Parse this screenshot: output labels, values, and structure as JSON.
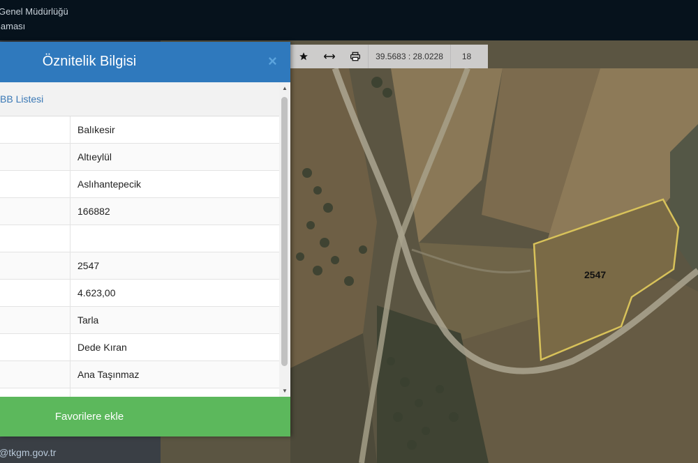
{
  "header": {
    "line1": "Genel Müdürlüğü",
    "line2": "laması"
  },
  "footer": {
    "email": "@tkgm.gov.tr"
  },
  "toolbar": {
    "star_icon": "star-icon",
    "measure_icon": "arrows-horizontal-icon",
    "print_icon": "print-icon",
    "coordinates": "39.5683 : 28.0228",
    "zoom_level": "18"
  },
  "map": {
    "parcel_label": "2547"
  },
  "panel": {
    "title": "Öznitelik Bilgisi",
    "close_symbol": "×",
    "section_title": "BB Listesi",
    "rows": [
      {
        "value": "Balıkesir"
      },
      {
        "value": "Altıeylül"
      },
      {
        "value": "Aslıhantepecik"
      },
      {
        "value": "166882"
      },
      {
        "value": ""
      },
      {
        "value": "2547"
      },
      {
        "value": "4.623,00"
      },
      {
        "value": "Tarla"
      },
      {
        "value": "Dede Kıran"
      },
      {
        "value": "Ana Taşınmaz"
      },
      {
        "value": ""
      }
    ],
    "favorite_button": "Favorilere ekle"
  },
  "colors": {
    "header_blue": "#2f79bd",
    "button_green": "#5cb85c",
    "parcel_outline": "#d8c25a"
  }
}
